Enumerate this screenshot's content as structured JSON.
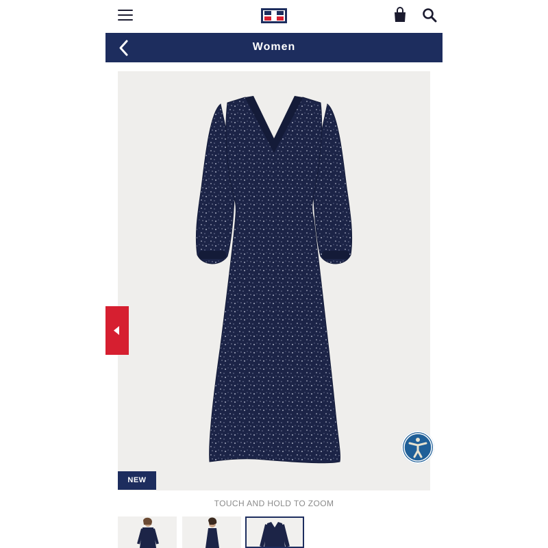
{
  "header": {
    "menu_icon": "hamburger-menu-icon",
    "logo": "tommy-hilfiger-flag-logo",
    "bag_icon": "shopping-bag-icon",
    "search_icon": "search-icon"
  },
  "nav": {
    "title": "Women",
    "back_icon": "chevron-left-icon"
  },
  "product": {
    "badge": "NEW",
    "zoom_hint": "TOUCH AND HOLD TO ZOOM",
    "prev_icon": "caret-left-icon",
    "accessibility_icon": "accessibility-person-icon"
  },
  "thumbnails": [
    {
      "name": "model-front",
      "active": false
    },
    {
      "name": "model-side",
      "active": false
    },
    {
      "name": "product-flat",
      "active": true
    }
  ],
  "colors": {
    "navy": "#1d2d5e",
    "red": "#d61f30",
    "accessibility_blue": "#1f5f98",
    "image_bg": "#efeeec"
  }
}
